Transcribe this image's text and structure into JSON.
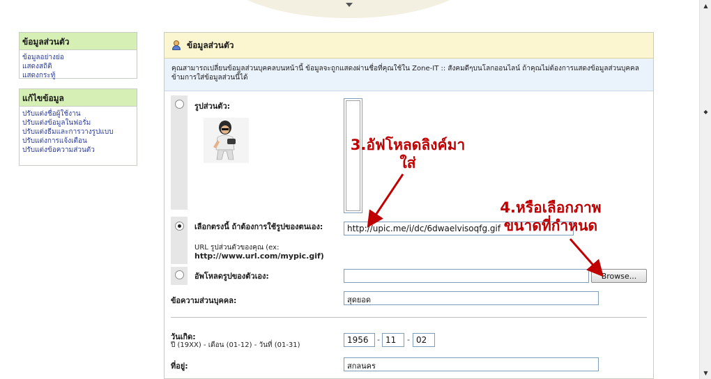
{
  "sidebar": {
    "section1": {
      "title": "ข้อมูลส่วนตัว",
      "links": [
        "ข้อมูลอย่างย่อ",
        "แสดงสถิติ",
        "แสดงกระทู้"
      ]
    },
    "section2": {
      "title": "แก้ไขข้อมูล",
      "links": [
        "ปรับแต่งชื่อผู้ใช้งาน",
        "ปรับแต่งข้อมูลในฟอรั่ม",
        "ปรับแต่งธีมและการวางรูปแบบ",
        "ปรับแต่งการแจ้งเตือน",
        "ปรับแต่งข้อความส่วนตัว"
      ]
    }
  },
  "panel": {
    "title": "ข้อมูลส่วนตัว",
    "description": "คุณสามารถเปลี่ยนข้อมูลส่วนบุคคลบนหน้านี้ ข้อมูลจะถูกแสดงผ่านชื่อที่คุณใช้ใน Zone-IT :: สังคมดีๆบนโลกออนไลน์ ถ้าคุณไม่ต้องการแสดงข้อมูลส่วนบุคคล ข้ามการใส่ข้อมูลส่วนนี้ได้"
  },
  "form": {
    "avatar_label": "รูปส่วนตัว:",
    "own_url_label": "เลือกตรงนี้ ถ้าต้องการใช้รูปของตนเอง:",
    "own_url_hint": "URL รูปส่วนตัวของคุณ (ex:",
    "own_url_example": "http://www.url.com/mypic.gif)",
    "own_url_value": "http://upic.me/i/dc/6dwaelvisoqfg.gif",
    "upload_label": "อัพโหลดรูปของตัวเอง:",
    "upload_value": "",
    "browse_label": "Browse...",
    "personal_text_label": "ข้อความส่วนบุคคล:",
    "personal_text_value": "สุดยอด",
    "birthdate_label": "วันเกิด:",
    "birthdate_hint": "ปี (19XX) - เดือน (01-12) - วันที่ (01-31)",
    "birth_year": "1956",
    "birth_month": "11",
    "birth_day": "02",
    "dash": "-",
    "location_label": "ที่อยู่:",
    "location_value": "สกลนคร"
  },
  "annotations": {
    "step3_line1": "3.อัฟโหลดลิงค์มา",
    "step3_line2": "ใส่",
    "step4_line1": "4.หรือเลือกภาพ",
    "step4_line2": "ขนาดที่กำหนด"
  },
  "colors": {
    "sidebar_header": "#d6efb4",
    "panel_header": "#fbf6cf",
    "panel_desc": "#eaf2fb",
    "link": "#2a3b9c",
    "annotation": "#c00000"
  }
}
